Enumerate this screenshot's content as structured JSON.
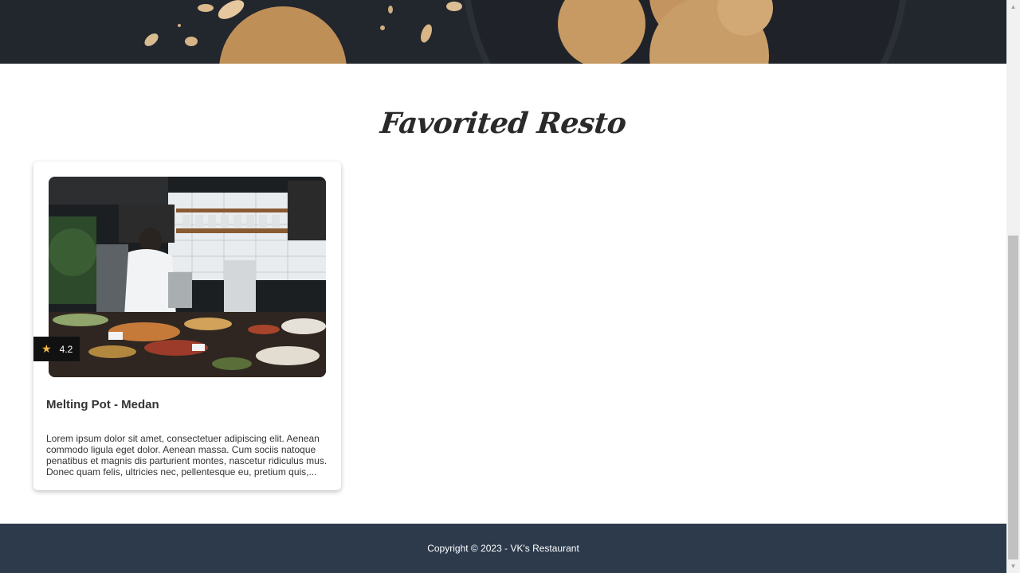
{
  "section": {
    "title": "Favorited Resto"
  },
  "restaurants": [
    {
      "name": "Melting Pot - Medan",
      "rating": "4.2",
      "description": "Lorem ipsum dolor sit amet, consectetuer adipiscing elit. Aenean commodo ligula eget dolor. Aenean massa. Cum sociis natoque penatibus et magnis dis parturient montes, nascetur ridiculus mus. Donec quam felis, ultricies nec, pellentesque eu, pretium quis,..."
    }
  ],
  "footer": {
    "copyright": "Copyright © 2023 - VK's Restaurant"
  },
  "colors": {
    "footer_bg": "#2c3a4c",
    "star": "#f5b942",
    "rating_bg": "#111111"
  },
  "icons": {
    "rating": "star-icon"
  }
}
